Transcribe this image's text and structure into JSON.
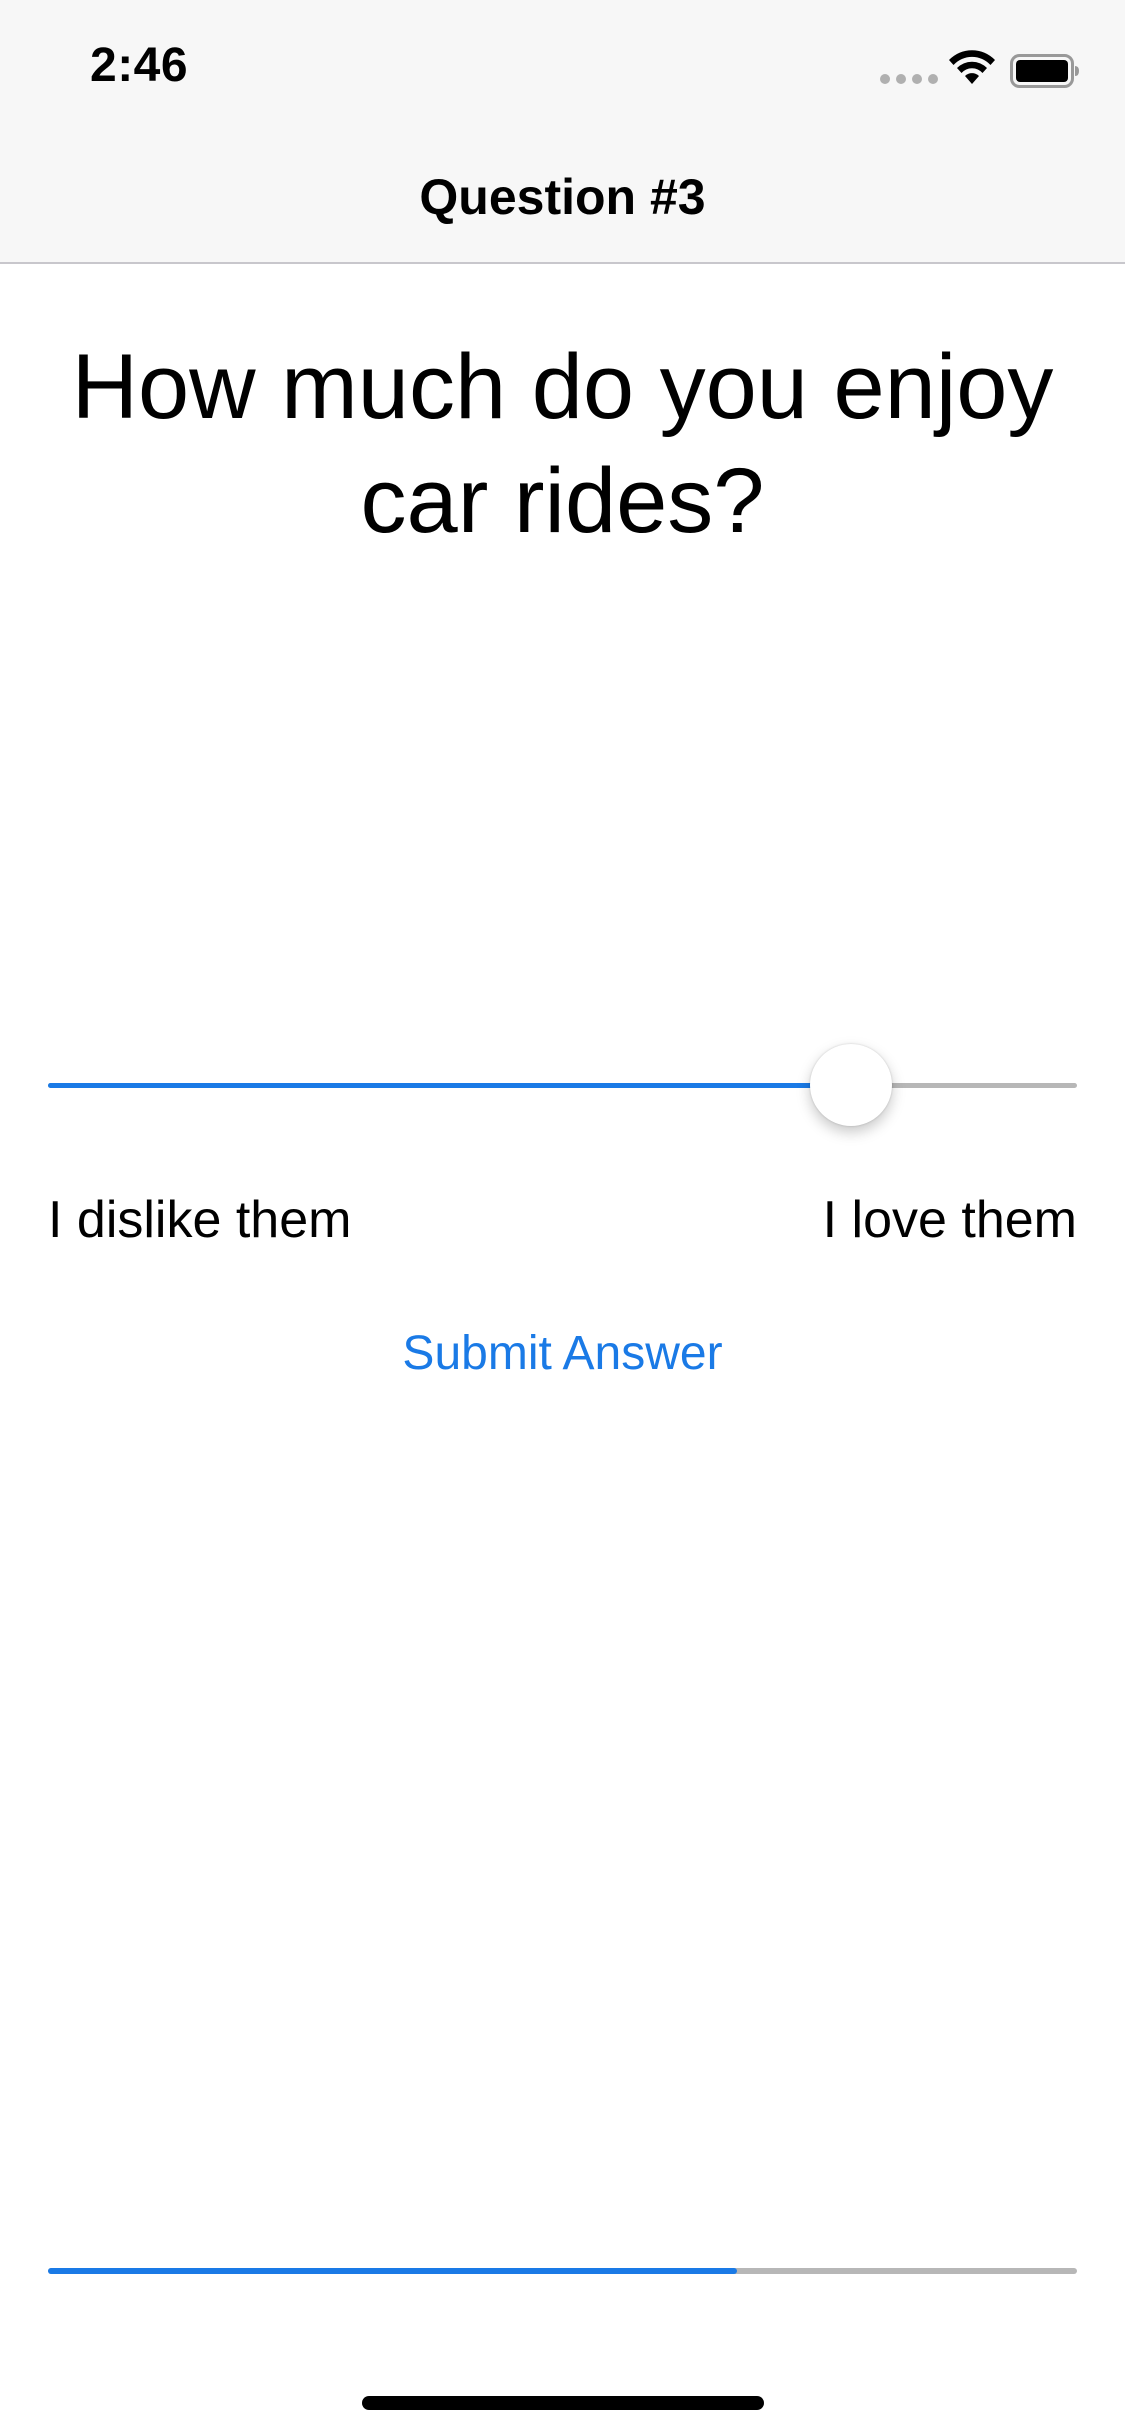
{
  "status_bar": {
    "time": "2:46",
    "icons": [
      "cellular-signal-icon",
      "wifi-icon",
      "battery-icon"
    ]
  },
  "nav": {
    "title": "Question #3"
  },
  "question": {
    "text": "How much do you enjoy car rides?"
  },
  "slider": {
    "value_fraction": 0.78,
    "min_label": "I dislike them",
    "max_label": "I love them"
  },
  "actions": {
    "submit_label": "Submit Answer"
  },
  "progress": {
    "value_fraction": 0.67
  },
  "colors": {
    "accent": "#1a7ae6",
    "track": "#b7b7b7",
    "nav_background": "#f7f7f7",
    "text": "#000000"
  }
}
